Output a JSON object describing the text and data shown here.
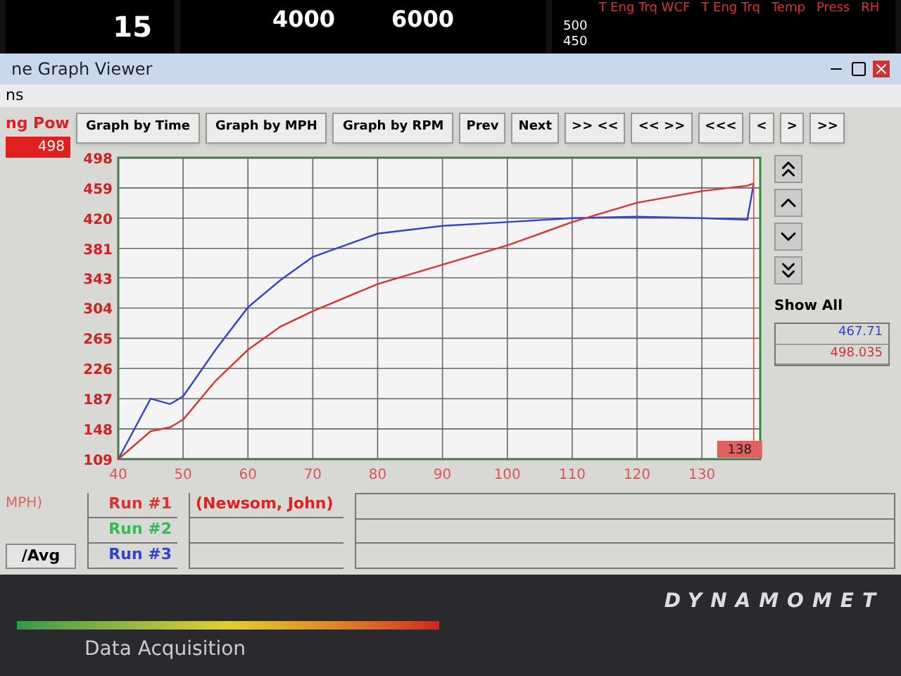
{
  "dashboard": {
    "gauge_left": {
      "reading": "15"
    },
    "tach": {
      "ticks": [
        "4000",
        "6000"
      ]
    },
    "bar_panel": {
      "labels": [
        "T Eng Trq WCF",
        "T Eng Trq",
        "Temp",
        "Press",
        "RH"
      ],
      "scale": [
        "500",
        "450"
      ]
    }
  },
  "window": {
    "title": "ne Graph Viewer",
    "menu": [
      "ns"
    ]
  },
  "side_readout": {
    "label": "ng Pow",
    "value": "498"
  },
  "toolbar": [
    {
      "label": "Graph by Time",
      "kind": "wide"
    },
    {
      "label": "Graph by MPH",
      "kind": "wide"
    },
    {
      "label": "Graph by RPM",
      "kind": "wide"
    },
    {
      "label": "Prev",
      "kind": "small"
    },
    {
      "label": "Next",
      "kind": "small"
    },
    {
      "label": ">> <<",
      "kind": "small"
    },
    {
      "label": "<< >>",
      "kind": "small"
    },
    {
      "label": "<<<",
      "kind": "small"
    },
    {
      "label": "<",
      "kind": "tiny"
    },
    {
      "label": ">",
      "kind": "tiny"
    },
    {
      "label": ">>",
      "kind": "tiny"
    }
  ],
  "chart": {
    "chart_data": {
      "type": "line",
      "x": [
        40,
        45,
        48,
        50,
        55,
        60,
        65,
        70,
        80,
        90,
        100,
        110,
        120,
        130,
        137,
        138
      ],
      "series": [
        {
          "color": "#3344cc",
          "values": [
            109,
            187,
            180,
            190,
            250,
            305,
            340,
            370,
            400,
            410,
            415,
            420,
            422,
            420,
            418,
            465
          ]
        },
        {
          "color": "#dd3333",
          "values": [
            109,
            145,
            150,
            160,
            210,
            250,
            280,
            300,
            335,
            360,
            385,
            415,
            440,
            455,
            462,
            465
          ]
        }
      ],
      "xlim": [
        40,
        139
      ],
      "ylim": [
        109,
        498
      ],
      "xticks": [
        40,
        50,
        60,
        70,
        80,
        90,
        100,
        110,
        120,
        130
      ],
      "yticks": [
        109,
        148,
        187,
        226,
        265,
        304,
        343,
        381,
        420,
        459,
        498
      ],
      "grid": true,
      "ref_lines": [
        {
          "axis": "x",
          "value": 138,
          "label": "138"
        }
      ]
    }
  },
  "right_panel": {
    "show_all": "Show All",
    "readings": [
      {
        "value": "467.71",
        "color": "#3344cc"
      },
      {
        "value": "498.035",
        "color": "#dd3333"
      }
    ]
  },
  "bottom": {
    "axis_label": "MPH)",
    "avg_button": "/Avg",
    "runs": [
      {
        "label": "Run #1",
        "color": "#dd3333",
        "name": "(Newsom, John)"
      },
      {
        "label": "Run #2",
        "color": "#33bb55"
      },
      {
        "label": "Run #3",
        "color": "#3344cc"
      }
    ]
  },
  "banner": {
    "tagline": "DYNAMOMET",
    "subtitle": "Data Acquisition"
  }
}
